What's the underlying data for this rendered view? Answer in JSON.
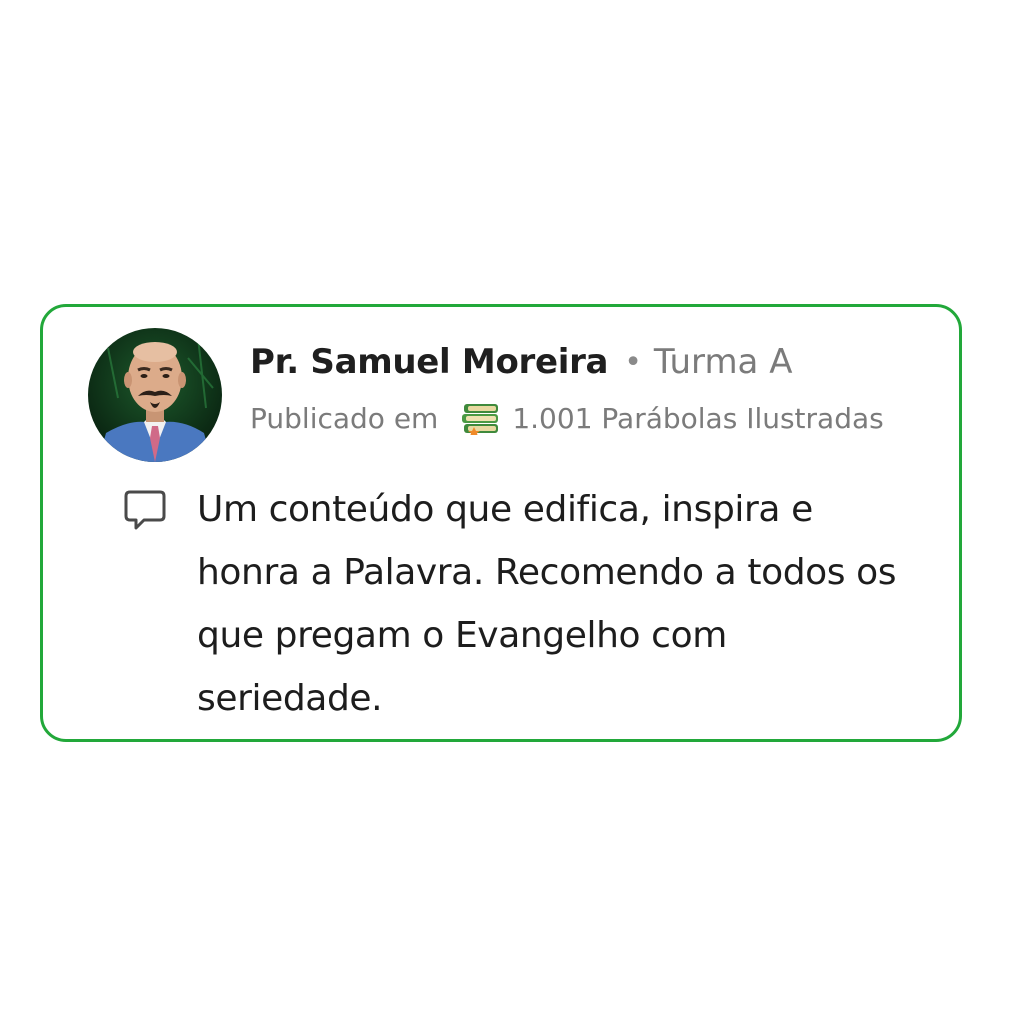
{
  "post": {
    "author_name": "Pr. Samuel Moreira",
    "separator": "•",
    "group_name": "Turma A",
    "published_prefix": "Publicado em",
    "course_icon": "books-icon",
    "course_name": "1.001 Parábolas Ilustradas",
    "comment_icon": "comment-bubble-icon",
    "comment_text": "Um conteúdo que edifica, inspira e honra a Palavra. Recomendo a todos os que pregam o Evangelho com seriedade."
  },
  "colors": {
    "border": "#22a83a",
    "author_text": "#1f1f1f",
    "muted_text": "#7b7b7b",
    "body_text": "#1d1d1d"
  }
}
